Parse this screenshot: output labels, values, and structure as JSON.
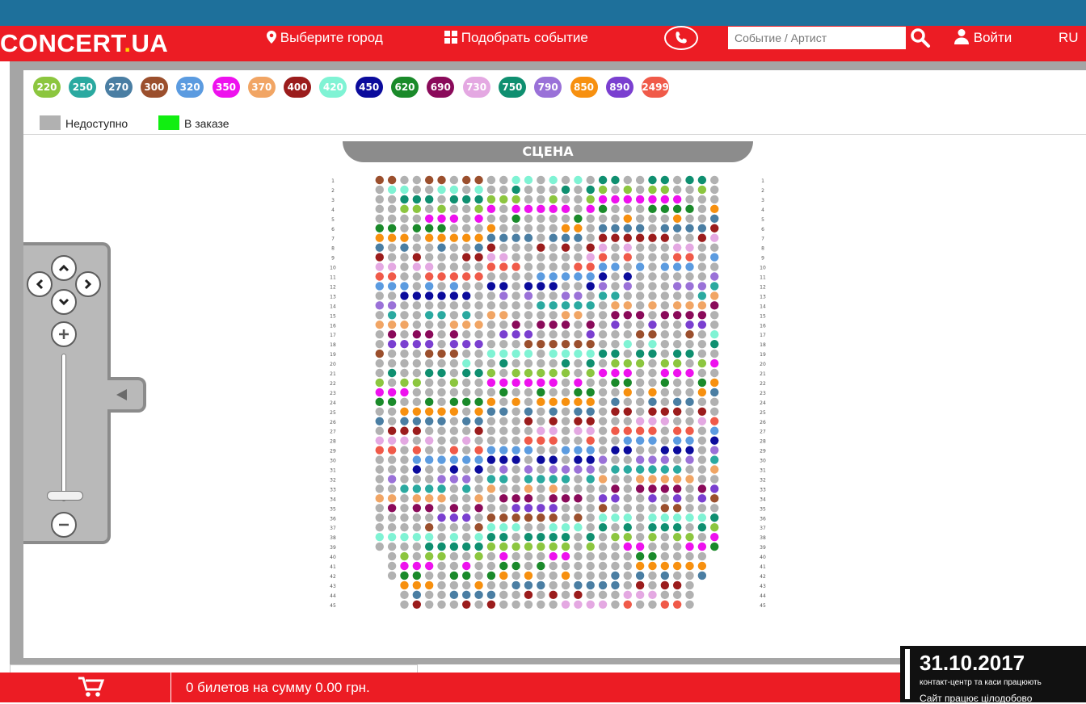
{
  "header": {
    "logo_main": "CONCERT",
    "logo_dot": ".",
    "logo_suffix": "UA",
    "city_label": "Выберите город",
    "pick_event_label": "Подобрать событие",
    "search_placeholder": "Событие / Артист",
    "login_label": "Войти",
    "language": "RU"
  },
  "prices": [
    {
      "label": "220",
      "color": "#8cc63f"
    },
    {
      "label": "250",
      "color": "#2aa9a0"
    },
    {
      "label": "270",
      "color": "#4a7ea3"
    },
    {
      "label": "300",
      "color": "#9b4f2d"
    },
    {
      "label": "320",
      "color": "#5b9be0"
    },
    {
      "label": "350",
      "color": "#ee11ee"
    },
    {
      "label": "370",
      "color": "#f1a564"
    },
    {
      "label": "400",
      "color": "#9b1c1c"
    },
    {
      "label": "420",
      "color": "#7ff3d4"
    },
    {
      "label": "450",
      "color": "#0b0b9c"
    },
    {
      "label": "620",
      "color": "#1a8a2a"
    },
    {
      "label": "690",
      "color": "#8a0a5a"
    },
    {
      "label": "730",
      "color": "#e4a8e2"
    },
    {
      "label": "750",
      "color": "#0f8f70"
    },
    {
      "label": "790",
      "color": "#9a71d8"
    },
    {
      "label": "850",
      "color": "#f7900f"
    },
    {
      "label": "890",
      "color": "#7a3fd0"
    },
    {
      "label": "2499",
      "color": "#f05a49"
    }
  ],
  "legend": {
    "unavailable_label": "Недоступно",
    "unavailable_color": "#b1b1b1",
    "in_order_label": "В заказе",
    "in_order_color": "#11ee11"
  },
  "stage_label": "СЦЕНА",
  "seatmap": {
    "row_count": 45,
    "row_numbers": [
      "1",
      "2",
      "3",
      "4",
      "5",
      "6",
      "7",
      "8",
      "9",
      "10",
      "11",
      "12",
      "13",
      "14",
      "15",
      "16",
      "17",
      "18",
      "19",
      "20",
      "21",
      "22",
      "23",
      "24",
      "25",
      "26",
      "27",
      "28",
      "29",
      "30",
      "31",
      "32",
      "33",
      "34",
      "35",
      "36",
      "37",
      "38",
      "39",
      "40",
      "41",
      "42",
      "43",
      "44",
      "45"
    ],
    "seats_per_row": [
      28,
      28,
      28,
      28,
      28,
      28,
      28,
      28,
      28,
      28,
      28,
      28,
      28,
      28,
      28,
      28,
      28,
      28,
      28,
      28,
      28,
      28,
      28,
      28,
      28,
      28,
      28,
      28,
      28,
      28,
      28,
      28,
      28,
      28,
      28,
      28,
      28,
      28,
      28,
      26,
      26,
      26,
      24,
      24,
      24
    ]
  },
  "footer": {
    "cart_text": "0 билетов на сумму 0.00 грн.",
    "date": "31.10.2017",
    "info_line1": "контакт-центр та каси працюють",
    "info_line2": "Сайт працює цілодобово"
  }
}
